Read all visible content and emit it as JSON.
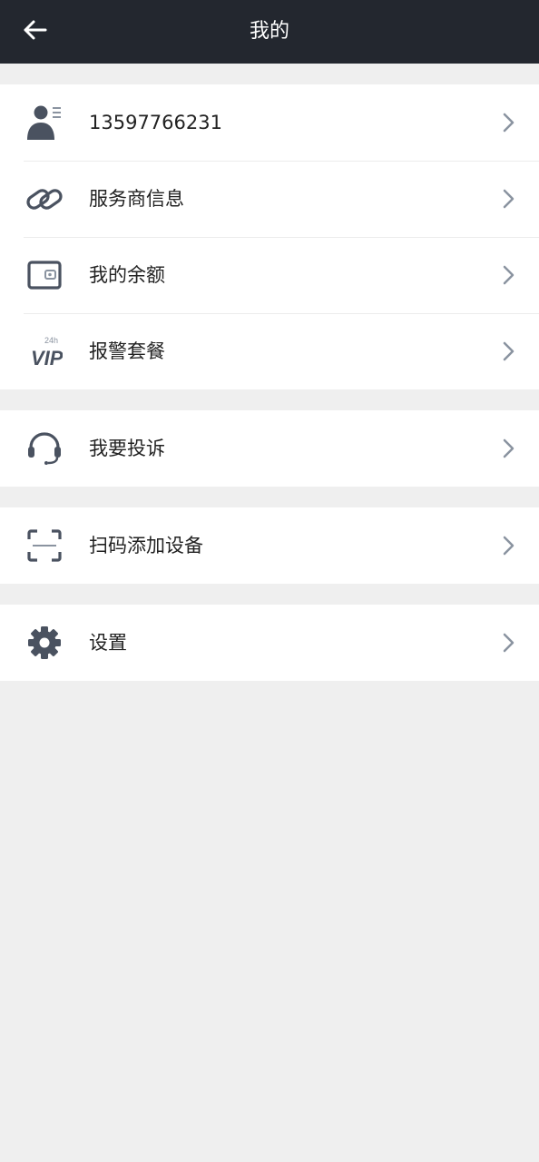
{
  "header": {
    "title": "我的",
    "back_icon": "arrow-left-icon"
  },
  "groups": [
    {
      "items": [
        {
          "label": "13597766231",
          "icon": "user-card-icon"
        },
        {
          "label": "服务商信息",
          "icon": "link-icon"
        },
        {
          "label": "我的余额",
          "icon": "wallet-icon"
        },
        {
          "label": "报警套餐",
          "icon": "vip-24h-icon",
          "icon_text_top": "24h",
          "icon_text_main": "VIP"
        }
      ]
    },
    {
      "items": [
        {
          "label": "我要投诉",
          "icon": "headset-icon"
        }
      ]
    },
    {
      "items": [
        {
          "label": "扫码添加设备",
          "icon": "scan-icon"
        }
      ]
    },
    {
      "items": [
        {
          "label": "设置",
          "icon": "gear-icon"
        }
      ]
    }
  ],
  "colors": {
    "header_bg": "#23272f",
    "page_bg": "#efefef",
    "icon": "#4a5260",
    "chevron": "#8a93a0",
    "text": "#222222"
  }
}
